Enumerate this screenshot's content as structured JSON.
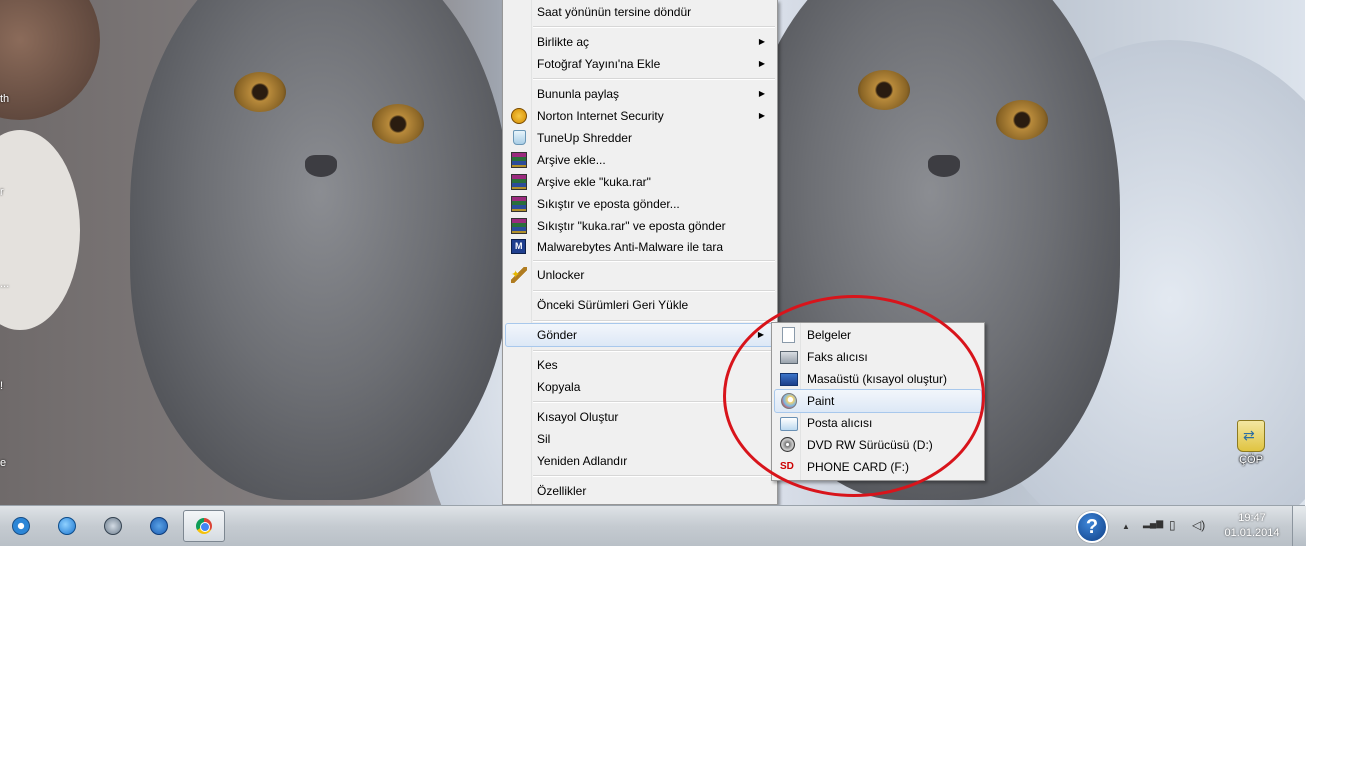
{
  "desktop": {
    "edge_labels": [
      "th",
      "r",
      "r",
      "...",
      "!",
      "e"
    ],
    "recycle_bin_label": "ÇÖP"
  },
  "context_menu": {
    "items": [
      {
        "label": "Saat yönünün tersine döndür"
      },
      {
        "label": "Birlikte aç",
        "has_submenu": true
      },
      {
        "label": "Fotoğraf Yayını'na Ekle",
        "has_submenu": true
      },
      {
        "label": "Bununla paylaş",
        "has_submenu": true
      },
      {
        "label": "Norton Internet Security",
        "icon": "norton-icon",
        "has_submenu": true
      },
      {
        "label": "TuneUp Shredder",
        "icon": "shredder-icon"
      },
      {
        "label": "Arşive ekle...",
        "icon": "winrar-icon"
      },
      {
        "label": "Arşive ekle \"kuka.rar\"",
        "icon": "winrar-icon"
      },
      {
        "label": "Sıkıştır ve eposta gönder...",
        "icon": "winrar-icon"
      },
      {
        "label": "Sıkıştır \"kuka.rar\" ve eposta gönder",
        "icon": "winrar-icon"
      },
      {
        "label": "Malwarebytes Anti-Malware ile tara",
        "icon": "malwarebytes-icon"
      },
      {
        "label": "Unlocker",
        "icon": "unlocker-wand-icon"
      },
      {
        "label": "Önceki Sürümleri Geri Yükle"
      },
      {
        "label": "Gönder",
        "has_submenu": true,
        "highlighted": true
      },
      {
        "label": "Kes"
      },
      {
        "label": "Kopyala"
      },
      {
        "label": "Kısayol Oluştur"
      },
      {
        "label": "Sil"
      },
      {
        "label": "Yeniden Adlandır"
      },
      {
        "label": "Özellikler"
      }
    ],
    "submenu_arrow": "▶"
  },
  "send_to_menu": {
    "items": [
      {
        "label": "Belgeler",
        "icon": "documents-icon"
      },
      {
        "label": "Faks alıcısı",
        "icon": "fax-icon"
      },
      {
        "label": "Masaüstü (kısayol oluştur)",
        "icon": "desktop-icon"
      },
      {
        "label": "Paint",
        "icon": "paint-icon",
        "highlighted": true
      },
      {
        "label": "Posta alıcısı",
        "icon": "mail-icon"
      },
      {
        "label": "DVD RW Sürücüsü (D:)",
        "icon": "dvd-drive-icon"
      },
      {
        "label": "PHONE CARD (F:)",
        "icon": "sd-card-icon"
      }
    ],
    "sd_icon_text": "SD"
  },
  "annotation": {
    "color": "#d8141b"
  },
  "taskbar": {
    "pinned": [
      "itunes-icon",
      "internet-explorer-icon",
      "media-player-icon",
      "flash-icon",
      "chrome-icon"
    ],
    "help_glyph": "?",
    "tray": {
      "expand": "▲",
      "signal": "▂▄▆",
      "power": "▯",
      "volume": "◁)"
    },
    "clock": {
      "time": "19:47",
      "date": "01.01.2014"
    }
  }
}
